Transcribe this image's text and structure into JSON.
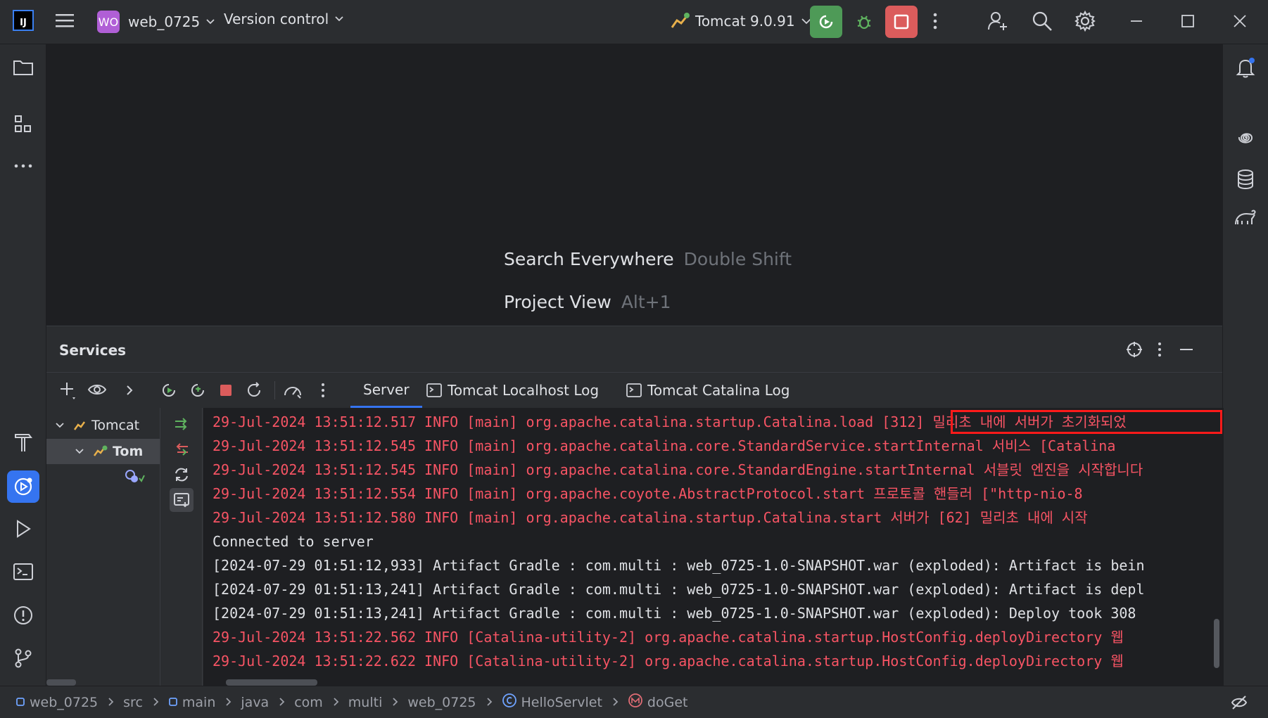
{
  "titlebar": {
    "app_logo": "IJ",
    "project_badge": "WO",
    "project_name": "web_0725",
    "vcs_label": "Version control",
    "run_config": "Tomcat 9.0.91",
    "icons": [
      "hamburger-menu-icon",
      "chevron-down-icon",
      "rerun-icon",
      "debug-bug-icon",
      "stop-icon",
      "more-vertical-icon",
      "add-user-icon",
      "search-icon",
      "gear-icon",
      "minimize-icon",
      "maximize-icon",
      "close-icon"
    ],
    "colors": {
      "rerun_bg": "#4e9a57",
      "stop_bg": "#db5c5c",
      "badge_bg": "#b05fd6"
    }
  },
  "left_strip": {
    "items": [
      "folder-icon",
      "structure-icon",
      "more-horizontal-icon",
      "build-hammer-icon",
      "services-icon",
      "run-icon",
      "terminal-icon",
      "problems-icon",
      "git-branch-icon"
    ],
    "active": "services-icon"
  },
  "right_strip": {
    "items": [
      "notifications-icon",
      "ai-spiral-icon",
      "database-icon",
      "gradle-elephant-icon"
    ]
  },
  "editor": {
    "hints": [
      {
        "action": "Search Everywhere",
        "shortcut": "Double Shift"
      },
      {
        "action": "Project View",
        "shortcut": "Alt+1"
      }
    ]
  },
  "services": {
    "title": "Services",
    "tabs": [
      {
        "label": "Server",
        "selected": true
      },
      {
        "label": "Tomcat Localhost Log",
        "selected": false
      },
      {
        "label": "Tomcat Catalina Log",
        "selected": false
      }
    ],
    "tree": {
      "root": "Tomcat",
      "child": "Tom",
      "child_selected": true
    },
    "console_lines": [
      {
        "text": "29-Jul-2024 13:51:12.517 INFO [main] org.apache.catalina.startup.Catalina.load [312] 밀리초 내에 서버가 초기화되었",
        "color": "red"
      },
      {
        "text": "29-Jul-2024 13:51:12.545 INFO [main] org.apache.catalina.core.StandardService.startInternal 서비스 [Catalina",
        "color": "red"
      },
      {
        "text": "29-Jul-2024 13:51:12.545 INFO [main] org.apache.catalina.core.StandardEngine.startInternal 서블릿 엔진을 시작합니다",
        "color": "red"
      },
      {
        "text": "29-Jul-2024 13:51:12.554 INFO [main] org.apache.coyote.AbstractProtocol.start 프로토콜 핸들러 [\"http-nio-8",
        "color": "red"
      },
      {
        "text": "29-Jul-2024 13:51:12.580 INFO [main] org.apache.catalina.startup.Catalina.start 서버가 [62] 밀리초 내에 시작",
        "color": "red"
      },
      {
        "text": "Connected to server",
        "color": "white"
      },
      {
        "text": "[2024-07-29 01:51:12,933] Artifact Gradle : com.multi : web_0725-1.0-SNAPSHOT.war (exploded): Artifact is bein",
        "color": "white"
      },
      {
        "text": "[2024-07-29 01:51:13,241] Artifact Gradle : com.multi : web_0725-1.0-SNAPSHOT.war (exploded): Artifact is depl",
        "color": "white"
      },
      {
        "text": "[2024-07-29 01:51:13,241] Artifact Gradle : com.multi : web_0725-1.0-SNAPSHOT.war (exploded): Deploy took 308",
        "color": "white"
      },
      {
        "text": "29-Jul-2024 13:51:22.562 INFO [Catalina-utility-2] org.apache.catalina.startup.HostConfig.deployDirectory 웹",
        "color": "red"
      },
      {
        "text": "29-Jul-2024 13:51:22.622 INFO [Catalina-utility-2] org.apache.catalina.startup.HostConfig.deployDirectory 웹",
        "color": "red"
      }
    ],
    "colors": {
      "log_red": "#f75464",
      "highlight_box": "#ff1a1a",
      "tab_underline": "#3574f0"
    }
  },
  "statusbar": {
    "breadcrumbs": [
      {
        "label": "web_0725",
        "icon": "module-icon"
      },
      {
        "label": "src",
        "icon": ""
      },
      {
        "label": "main",
        "icon": "module-icon"
      },
      {
        "label": "java",
        "icon": ""
      },
      {
        "label": "com",
        "icon": ""
      },
      {
        "label": "multi",
        "icon": ""
      },
      {
        "label": "web_0725",
        "icon": ""
      },
      {
        "label": "HelloServlet",
        "icon": "class-icon"
      },
      {
        "label": "doGet",
        "icon": "method-icon"
      }
    ],
    "right_icon": "no-inspection-icon"
  }
}
